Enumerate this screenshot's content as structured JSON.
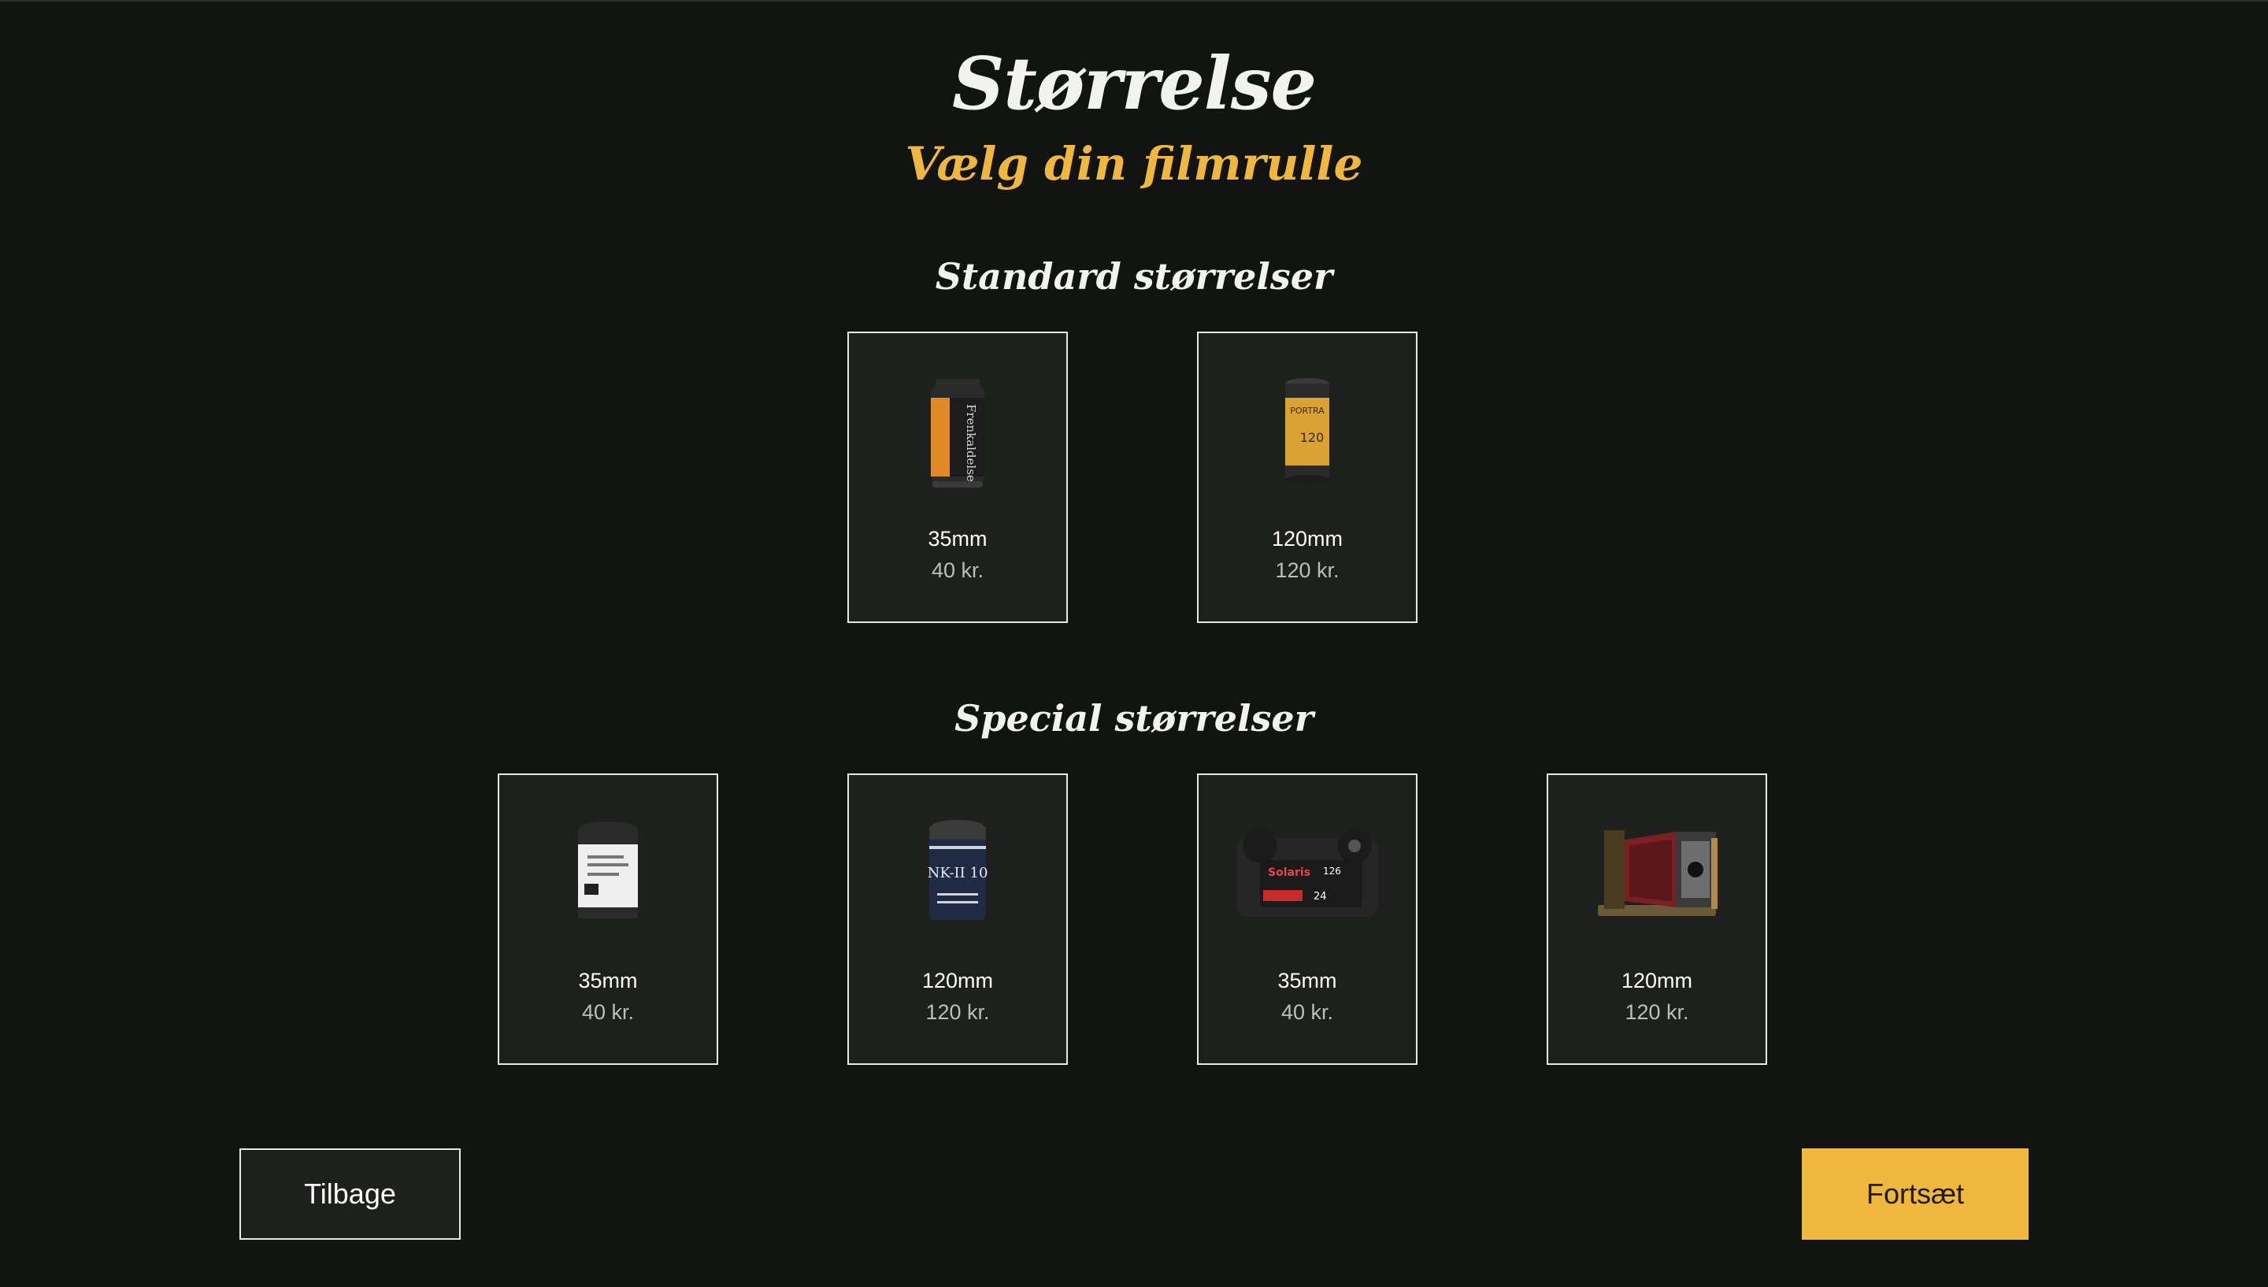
{
  "header": {
    "title": "Størrelse",
    "subtitle": "Vælg din filmrulle"
  },
  "sections": {
    "standard": {
      "title": "Standard størrelser",
      "items": [
        {
          "label": "35mm",
          "price": "40 kr.",
          "icon": "film-canister-35mm-icon"
        },
        {
          "label": "120mm",
          "price": "120 kr.",
          "icon": "film-roll-120-icon"
        }
      ]
    },
    "special": {
      "title": "Special størrelser",
      "items": [
        {
          "label": "35mm",
          "price": "40 kr.",
          "icon": "film-canister-white-icon"
        },
        {
          "label": "120mm",
          "price": "120 kr.",
          "icon": "film-canister-navy-icon"
        },
        {
          "label": "35mm",
          "price": "40 kr.",
          "icon": "film-cartridge-126-icon"
        },
        {
          "label": "120mm",
          "price": "120 kr.",
          "icon": "large-format-camera-icon"
        }
      ]
    }
  },
  "image_text": {
    "standard_35": "Frenkaldelse",
    "standard_120": "120",
    "standard_120_brand": "PORTRA",
    "special_navy": "NK-II 10",
    "special_cartridge": "Solaris",
    "special_cartridge_num": "126",
    "special_cartridge_exp": "24"
  },
  "footer": {
    "back_label": "Tilbage",
    "next_label": "Fortsæt"
  },
  "colors": {
    "background": "#121412",
    "card": "#1e201e",
    "accent": "#f0b73e"
  }
}
